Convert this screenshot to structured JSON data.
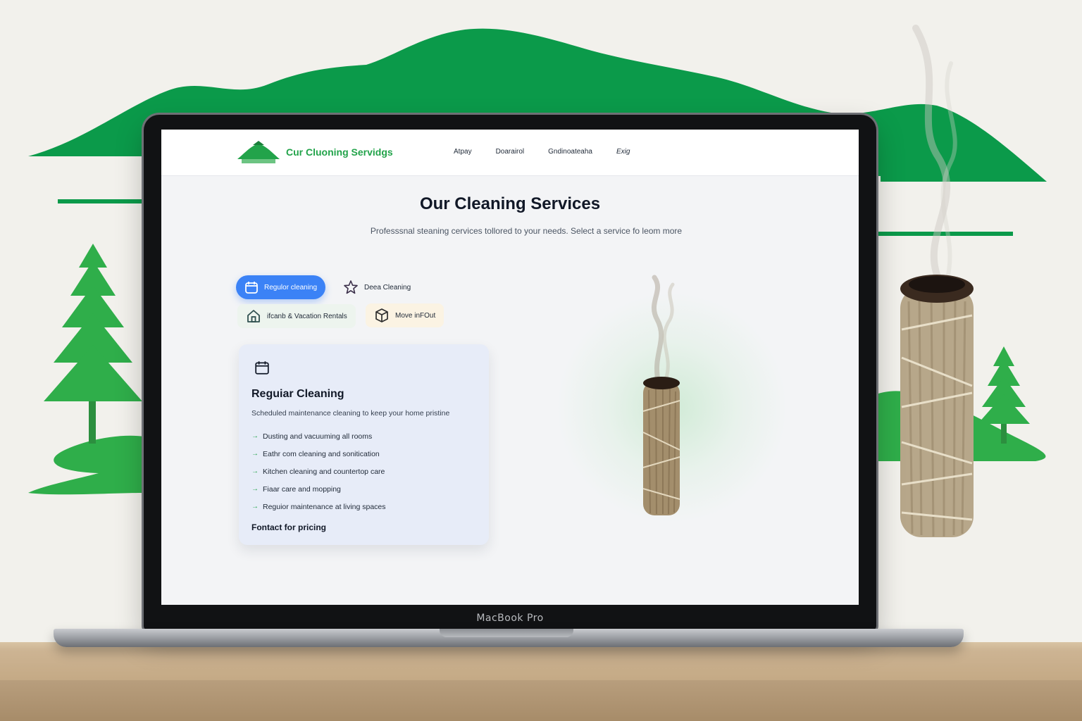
{
  "device": {
    "label": "MacBook Pro"
  },
  "site": {
    "brand_name": "Cur Cluoning Servidgs",
    "nav": [
      "Atpay",
      "Doarairol",
      "Gndinoateaha",
      "Exig"
    ]
  },
  "hero": {
    "title": "Our Cleaning Services",
    "subtitle": "Professsnal steaning cervices tollored to your needs. Select a service fo leom more"
  },
  "tabs": [
    {
      "label": "Regulor cleaning",
      "icon": "calendar-icon",
      "active": true
    },
    {
      "label": "Deea Cleaning",
      "icon": "star-icon",
      "active": false
    },
    {
      "label": "ifcanb & Vacation Rentals",
      "icon": "home-icon",
      "active": false
    },
    {
      "label": "Move inFOut",
      "icon": "box-icon",
      "active": false
    }
  ],
  "service_card": {
    "icon": "calendar-icon",
    "title": "Reguiar Cleaning",
    "description": "Scheduled maintenance cleaning to keep your home pristine",
    "features": [
      "Dusting and vacuuming all rooms",
      "Eathr com cleaning and sonitication",
      "Kitchen cleaning and countertop care",
      "Fiaar care and mopping",
      "Reguior maintenance at living spaces"
    ],
    "cta": "Fontact for pricing"
  },
  "colors": {
    "brand_green": "#22a34a",
    "accent_blue": "#3b82f6",
    "mountain_green": "#0b9a4a",
    "tree_green": "#2fae4a"
  }
}
